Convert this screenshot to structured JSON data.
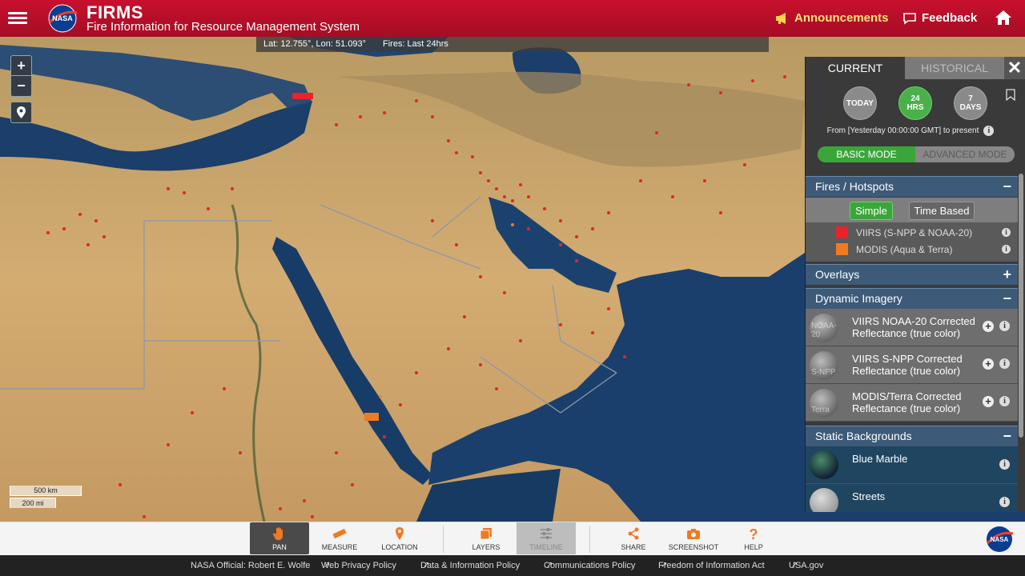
{
  "header": {
    "title": "FIRMS",
    "subtitle": "Fire Information for Resource Management System",
    "logo_text": "NASA",
    "announcements": "Announcements",
    "feedback": "Feedback"
  },
  "coord_bar": {
    "latlon": "Lat: 12.755°, Lon: 51.093°",
    "fires": "Fires: Last 24hrs"
  },
  "map_controls": {
    "zoom_in": "+",
    "zoom_out": "−"
  },
  "scale": {
    "km": "500 km",
    "mi": "200 mi"
  },
  "panel": {
    "tab_current": "CURRENT",
    "tab_historical": "HISTORICAL",
    "close": "✕",
    "period_today": "TODAY",
    "period_24_line1": "24",
    "period_24_line2": "HRS",
    "period_7_line1": "7",
    "period_7_line2": "DAYS",
    "from_text": "From [Yesterday 00:00:00 GMT] to present",
    "basic_mode": "BASIC MODE",
    "advanced_mode": "ADVANCED MODE",
    "fires_header": "Fires / Hotspots",
    "simple": "Simple",
    "time_based": "Time Based",
    "legend": [
      {
        "label": "VIIRS (S-NPP & NOAA-20)",
        "color": "#e8232b"
      },
      {
        "label": "MODIS (Aqua & Terra)",
        "color": "#f07a22"
      }
    ],
    "overlays_header": "Overlays",
    "dynamic_header": "Dynamic Imagery",
    "dynamic_items": [
      {
        "name": "VIIRS NOAA-20 Corrected Reflectance (true color)",
        "thumb": "NOAA-20"
      },
      {
        "name": "VIIRS S-NPP Corrected Reflectance (true color)",
        "thumb": "S-NPP"
      },
      {
        "name": "MODIS/Terra Corrected Reflectance (true color)",
        "thumb": "Terra"
      }
    ],
    "static_header": "Static Backgrounds",
    "static_items": [
      {
        "name": "Blue Marble"
      },
      {
        "name": "Streets"
      }
    ]
  },
  "toolbar": {
    "pan": "PAN",
    "measure": "MEASURE",
    "location": "LOCATION",
    "layers": "LAYERS",
    "timeline": "TIMELINE",
    "share": "SHARE",
    "screenshot": "SCREENSHOT",
    "help": "HELP"
  },
  "footer": {
    "official": "NASA Official: Robert E. Wolfe",
    "privacy": "Web Privacy Policy",
    "data_policy": "Data & Information Policy",
    "comm_policy": "Communications Policy",
    "foia": "Freedom of Information Act",
    "usagov": "USA.gov"
  },
  "colors": {
    "brand_red": "#c8102e",
    "fire_viirs": "#e8232b",
    "fire_modis": "#f07a22",
    "active_green": "#3aa63a",
    "section_blue": "#3d5a78"
  }
}
